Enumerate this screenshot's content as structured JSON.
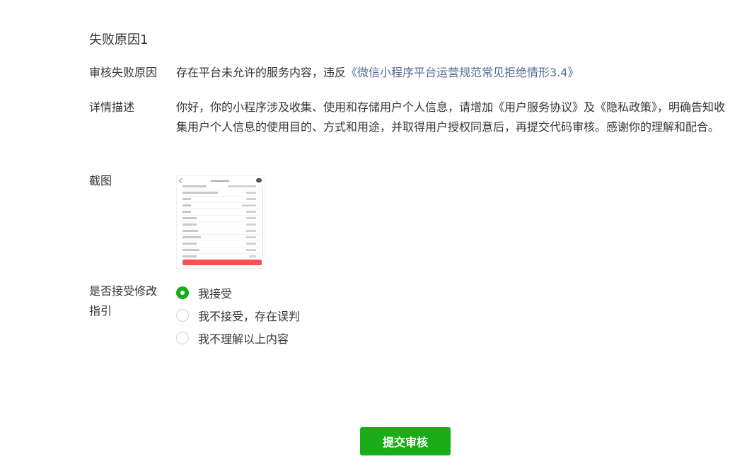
{
  "section_title": "失败原因1",
  "reason": {
    "label": "审核失败原因",
    "text": "存在平台未允许的服务内容，违反",
    "link": "《微信小程序平台运营规范常见拒绝情形3.4》"
  },
  "detail": {
    "label": "详情描述",
    "text": "你好，你的小程序涉及收集、使用和存储用户个人信息，请增加《用户服务协议》及《隐私政策》，明确告知收集用户个人信息的使用目的、方式和用途，并取得用户授权同意后，再提交代码审核。感谢你的理解和配合。"
  },
  "screenshot": {
    "label": "截图",
    "back_icon": "chevron-left-icon",
    "capsule_icon": "capsule-menu-icon",
    "button_color": "#fa5151"
  },
  "guide": {
    "label_line1": "是否接受修改",
    "label_line2": "指引",
    "options": [
      {
        "label": "我接受",
        "checked": true
      },
      {
        "label": "我不接受，存在误判",
        "checked": false
      },
      {
        "label": "我不理解以上内容",
        "checked": false
      }
    ]
  },
  "submit_label": "提交审核",
  "colors": {
    "accent": "#1aad19",
    "link": "#576b95",
    "text": "#353535"
  }
}
